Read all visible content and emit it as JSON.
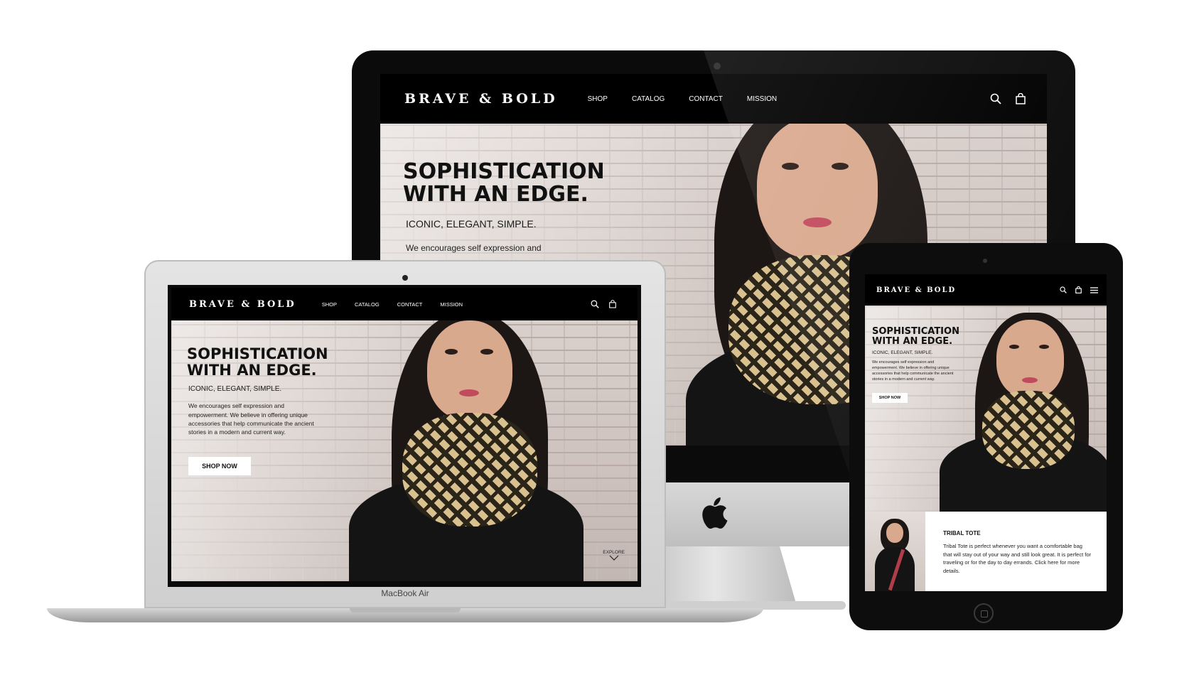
{
  "site": {
    "logo": "BRAVE & BOLD",
    "nav": [
      "SHOP",
      "CATALOG",
      "CONTACT",
      "MISSION"
    ],
    "headline_line1": "SOPHISTICATION",
    "headline_line2": "WITH AN EDGE.",
    "subheadline": "ICONIC, ELEGANT, SIMPLE.",
    "body": "We encourages self expression and empowerment. We believe in offering unique accessories that help communicate the ancient stories in a modern and current way.",
    "body_imac_partial": "We encourages self expression and",
    "cta": "SHOP NOW",
    "explore": "EXPLORE",
    "product_title": "TRIBAL TOTE",
    "product_desc": "Tribal Tote is perfect whenever you want a comfortable bag that will stay out of your way and still look great. It is perfect for traveling or for the day to  day  errands. Click here for more details."
  },
  "devices": {
    "laptop_label": "MacBook Air"
  },
  "icons": {
    "search": "search-icon",
    "bag": "shopping-bag-icon",
    "menu": "hamburger-menu-icon",
    "apple": "apple-logo-icon",
    "chevron": "chevron-down-icon"
  },
  "colors": {
    "nav_bg": "#000000",
    "scarf_gold": "#d8c08f",
    "scarf_dark": "#2a2419",
    "lips": "#c24a5d"
  }
}
